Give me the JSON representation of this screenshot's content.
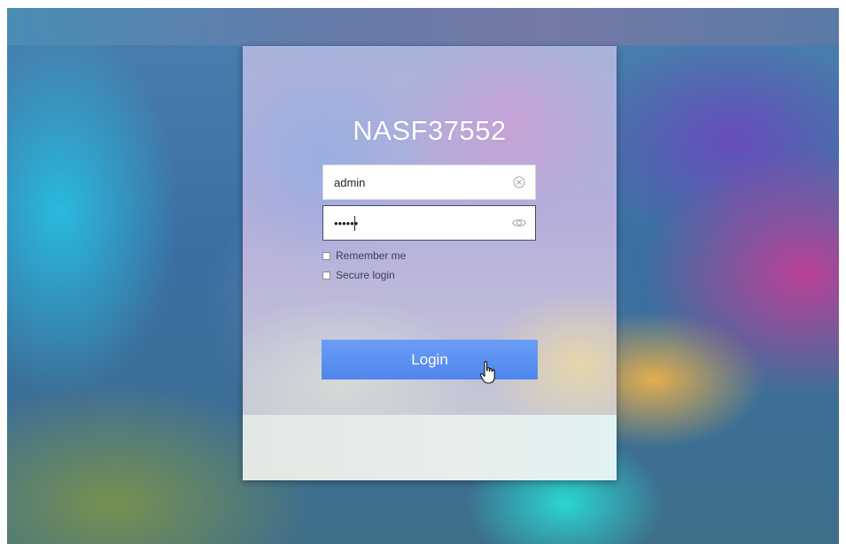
{
  "device": {
    "name": "NASF37552"
  },
  "login_form": {
    "username_value": "admin",
    "password_value": "••••••",
    "clear_icon": "clear-circle-icon",
    "show_password_icon": "eye-icon",
    "remember_label": "Remember me",
    "secure_label": "Secure login",
    "remember_checked": false,
    "secure_checked": false,
    "login_label": "Login"
  },
  "colors": {
    "login_button": "#5b8ff1",
    "title_text": "#ffffff"
  },
  "pointer": {
    "icon": "hand-pointer-icon"
  }
}
